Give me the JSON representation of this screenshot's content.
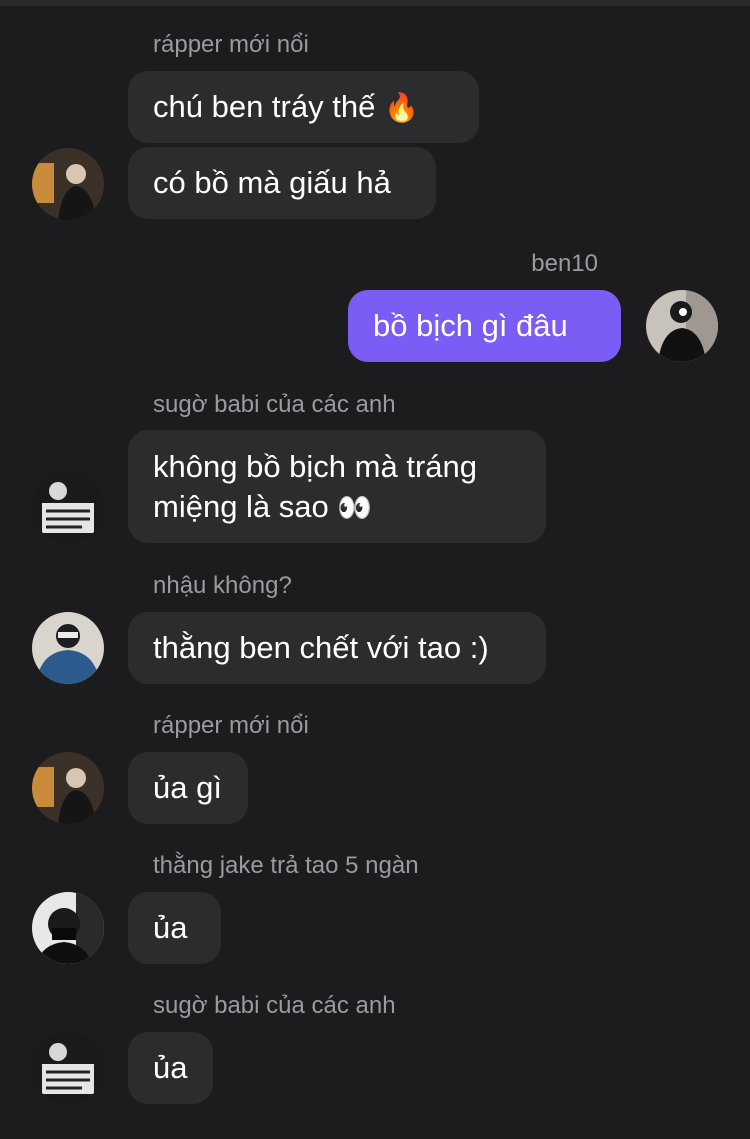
{
  "messages": [
    {
      "sender": "rápper mới nổi",
      "bubbles": [
        "chú ben tráy thế",
        "có bồ mà giấu hả"
      ],
      "emoji": "🔥"
    },
    {
      "sender": "ben10",
      "bubbles": [
        "bồ bịch gì đâu"
      ]
    },
    {
      "sender": "sugờ babi của các anh",
      "bubbles": [
        "không bồ bịch mà tráng",
        "miệng là sao"
      ],
      "emoji": "👀"
    },
    {
      "sender": "nhậu không?",
      "bubbles": [
        "thằng ben chết với tao :)"
      ]
    },
    {
      "sender": "rápper mới nổi",
      "bubbles": [
        "ủa gì"
      ]
    },
    {
      "sender": "thằng jake trả tao 5 ngàn",
      "bubbles": [
        "ủa"
      ]
    },
    {
      "sender": "sugờ babi của các anh",
      "bubbles": [
        "ủa"
      ]
    }
  ],
  "colors": {
    "background": "#1c1c1e",
    "incoming_bubble": "#2c2c2e",
    "outgoing_bubble": "#7b5cf5",
    "sender_name": "#9a9aa0"
  },
  "icons": [
    "user-avatar",
    "fire-emoji",
    "eyes-emoji"
  ]
}
